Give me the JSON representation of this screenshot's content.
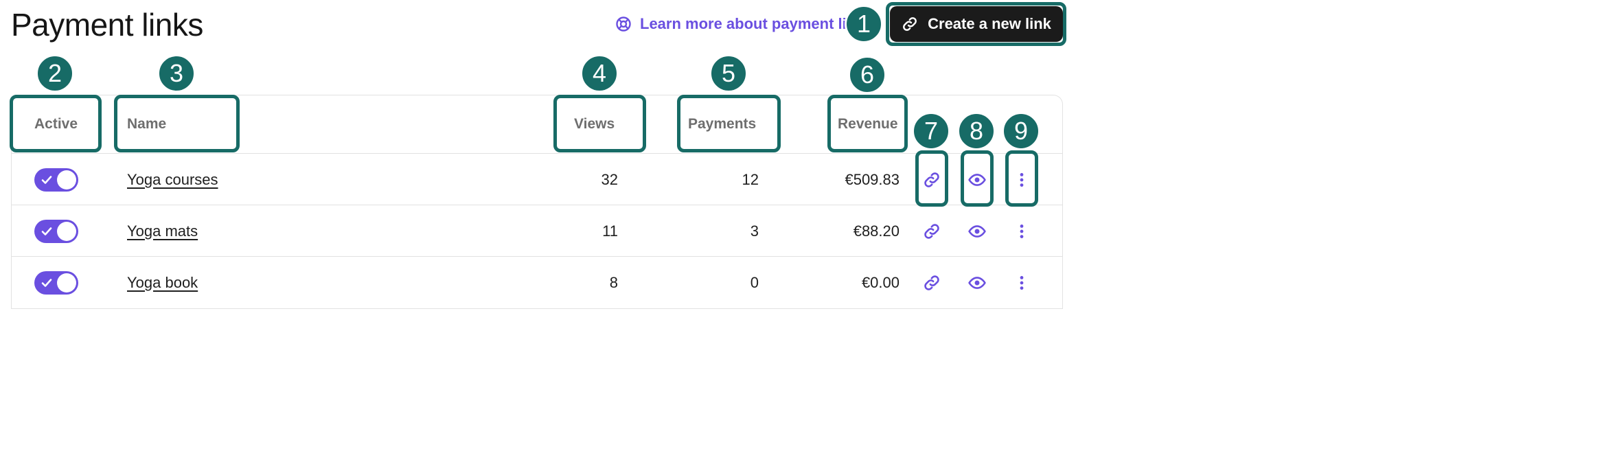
{
  "page": {
    "title": "Payment links"
  },
  "header": {
    "learn_more_label": "Learn more about payment links",
    "create_label": "Create a new link"
  },
  "table": {
    "columns": {
      "active": "Active",
      "name": "Name",
      "views": "Views",
      "payments": "Payments",
      "revenue": "Revenue"
    },
    "rows": [
      {
        "active": true,
        "name": "Yoga courses",
        "views": "32",
        "payments": "12",
        "revenue": "€509.83"
      },
      {
        "active": true,
        "name": "Yoga mats",
        "views": "11",
        "payments": "3",
        "revenue": "€88.20"
      },
      {
        "active": true,
        "name": "Yoga book",
        "views": "8",
        "payments": "0",
        "revenue": "€0.00"
      }
    ]
  },
  "annotations": [
    "1",
    "2",
    "3",
    "4",
    "5",
    "6",
    "7",
    "8",
    "9"
  ],
  "colors": {
    "accent": "#6a4fe0",
    "annotation": "#176b66",
    "button_bg": "#1b1b1b"
  },
  "icons": {
    "learn_more": "lifebuoy-icon",
    "create": "link-icon",
    "copy_link": "link-icon",
    "preview": "eye-icon",
    "more": "more-vertical-icon",
    "toggle_check": "check-icon"
  }
}
